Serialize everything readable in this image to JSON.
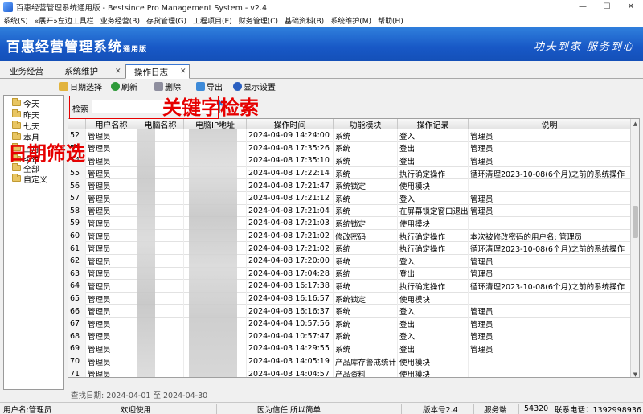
{
  "window": {
    "title": "百惠经营管理系统通用版 - Bestsince Pro Management System - v2.4",
    "controls": [
      "—",
      "☐",
      "✕"
    ]
  },
  "menu": [
    "系统(S)",
    "«展开»左边工具栏",
    "业务经营(B)",
    "存货管理(G)",
    "工程项目(E)",
    "财务管理(C)",
    "基础资料(B)",
    "系统维护(M)",
    "帮助(H)"
  ],
  "banner": {
    "brand": "百惠经营管理系统",
    "brand_sub": "通用版",
    "slogan": "功夫到家  服务到心"
  },
  "tabs": [
    {
      "label": "业务经营",
      "active": false,
      "closable": false
    },
    {
      "label": "系统维护",
      "active": false,
      "closable": true
    },
    {
      "label": "操作日志",
      "active": true,
      "closable": true
    }
  ],
  "toolbar": {
    "date_select": "日期选择",
    "refresh": "刷新",
    "delete": "删除",
    "export": "导出",
    "display_settings": "显示设置"
  },
  "tree": [
    "今天",
    "昨天",
    "七天",
    "本月",
    "上月",
    "今年",
    "全部",
    "自定义"
  ],
  "search": {
    "label": "检索",
    "value": ""
  },
  "annotations": {
    "search": "关键字检索",
    "date": "日期筛选"
  },
  "grid": {
    "columns": [
      "",
      "用户名称",
      "电脑名称",
      "电脑IP地址",
      "操作时间",
      "功能模块",
      "操作记录",
      "说明"
    ],
    "rows": [
      [
        "52",
        "管理员",
        "",
        "",
        "2024-04-09 14:24:00",
        "系统",
        "登入",
        "管理员"
      ],
      [
        "53",
        "管理员",
        "",
        "",
        "2024-04-08 17:35:26",
        "系统",
        "登出",
        "管理员"
      ],
      [
        "54",
        "管理员",
        "",
        "",
        "2024-04-08 17:35:10",
        "系统",
        "登出",
        "管理员"
      ],
      [
        "55",
        "管理员",
        "",
        "",
        "2024-04-08 17:22:14",
        "系统",
        "执行确定操作",
        "循环清理2023-10-08(6个月)之前的系统操作"
      ],
      [
        "56",
        "管理员",
        "",
        "",
        "2024-04-08 17:21:47",
        "系统锁定",
        "使用模块",
        ""
      ],
      [
        "57",
        "管理员",
        "",
        "",
        "2024-04-08 17:21:12",
        "系统",
        "登入",
        "管理员"
      ],
      [
        "58",
        "管理员",
        "",
        "",
        "2024-04-08 17:21:04",
        "系统",
        "在屏幕锁定窗口退出",
        "管理员"
      ],
      [
        "59",
        "管理员",
        "",
        "",
        "2024-04-08 17:21:03",
        "系统锁定",
        "使用模块",
        ""
      ],
      [
        "60",
        "管理员",
        "",
        "",
        "2024-04-08 17:21:02",
        "修改密码",
        "执行确定操作",
        "本次被修改密码的用户名: 管理员"
      ],
      [
        "61",
        "管理员",
        "",
        "",
        "2024-04-08 17:21:02",
        "系统",
        "执行确定操作",
        "循环清理2023-10-08(6个月)之前的系统操作"
      ],
      [
        "62",
        "管理员",
        "",
        "",
        "2024-04-08 17:20:00",
        "系统",
        "登入",
        "管理员"
      ],
      [
        "63",
        "管理员",
        "",
        "",
        "2024-04-08 17:04:28",
        "系统",
        "登出",
        "管理员"
      ],
      [
        "64",
        "管理员",
        "",
        "",
        "2024-04-08 16:17:38",
        "系统",
        "执行确定操作",
        "循环清理2023-10-08(6个月)之前的系统操作"
      ],
      [
        "65",
        "管理员",
        "",
        "",
        "2024-04-08 16:16:57",
        "系统锁定",
        "使用模块",
        ""
      ],
      [
        "66",
        "管理员",
        "",
        "",
        "2024-04-08 16:16:37",
        "系统",
        "登入",
        "管理员"
      ],
      [
        "67",
        "管理员",
        "",
        "",
        "2024-04-04 10:57:56",
        "系统",
        "登出",
        "管理员"
      ],
      [
        "68",
        "管理员",
        "",
        "",
        "2024-04-04 10:57:47",
        "系统",
        "登入",
        "管理员"
      ],
      [
        "69",
        "管理员",
        "",
        "",
        "2024-04-03 14:29:55",
        "系统",
        "登出",
        "管理员"
      ],
      [
        "70",
        "管理员",
        "",
        "",
        "2024-04-03 14:05:19",
        "产品库存警戒统计",
        "使用模块",
        ""
      ],
      [
        "71",
        "管理员",
        "",
        "",
        "2024-04-03 14:04:57",
        "产品资料",
        "使用模块",
        ""
      ]
    ]
  },
  "filter_text": "查找日期: 2024-04-01 至 2024-04-30",
  "status": {
    "user": "用户名:管理员",
    "welcome": "欢迎使用",
    "motto": "因为信任 所以简单",
    "version": "版本号2.4",
    "service": "服务端",
    "port": "54320",
    "phone": "联系电话：1392998936"
  }
}
